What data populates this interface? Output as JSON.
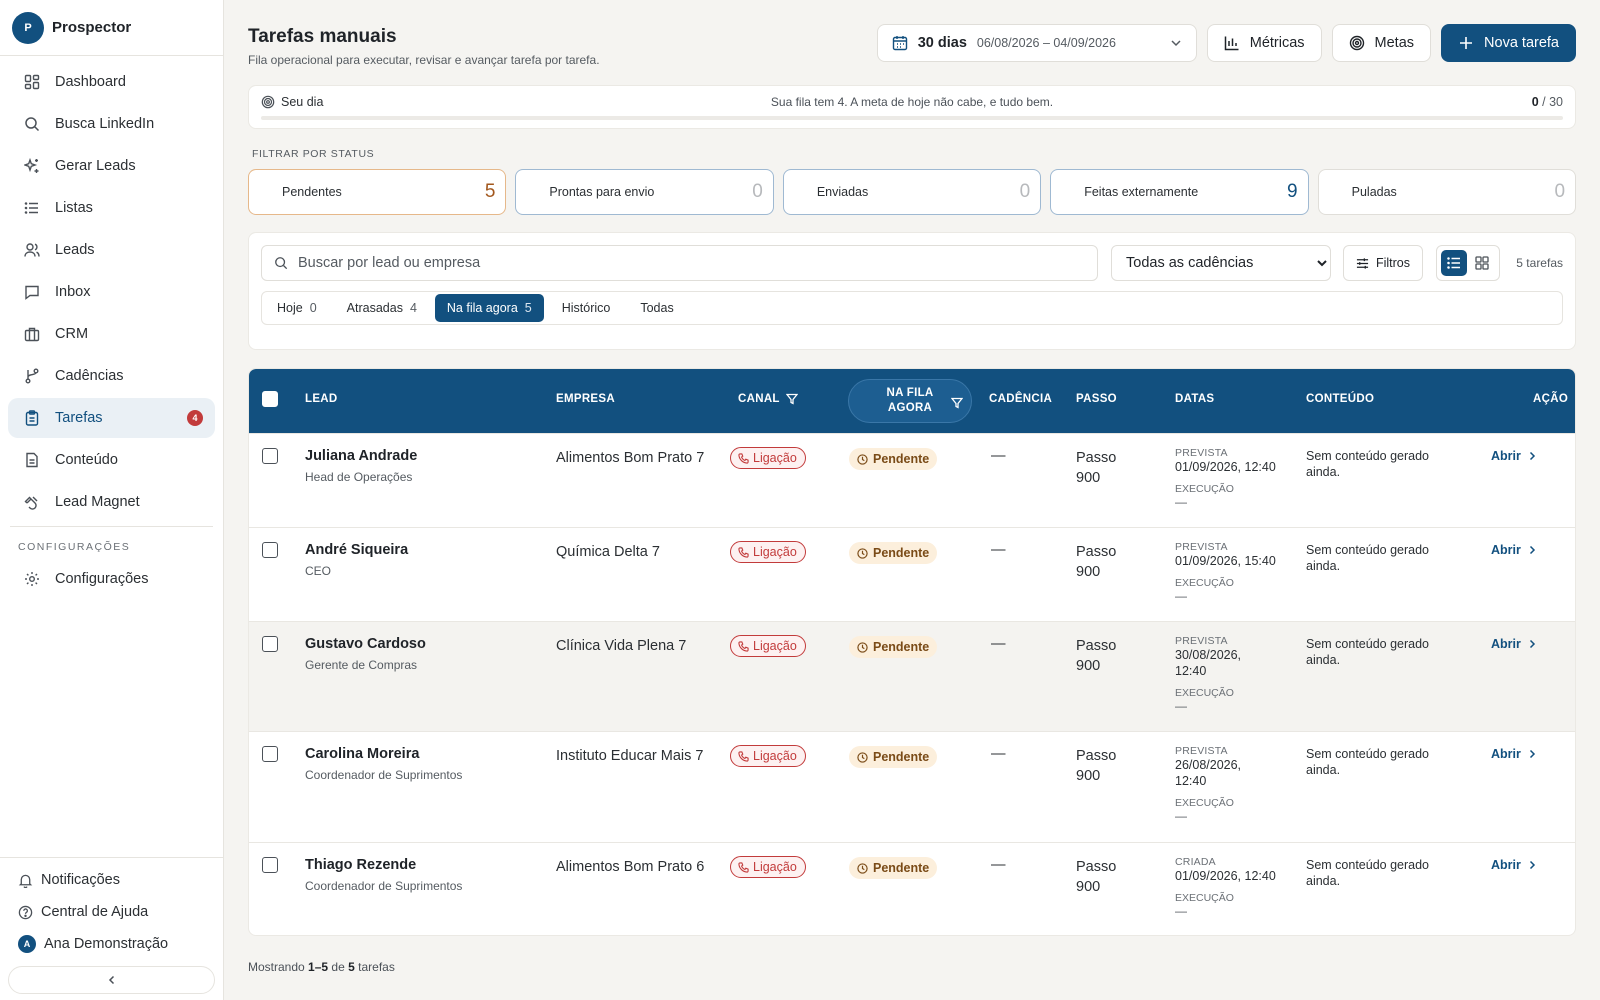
{
  "app": {
    "name": "Prospector",
    "logo_letter": "P"
  },
  "sidebar": {
    "items": [
      {
        "label": "Dashboard",
        "icon": "dashboard-icon"
      },
      {
        "label": "Busca LinkedIn",
        "icon": "search-icon"
      },
      {
        "label": "Gerar Leads",
        "icon": "sparkles-icon"
      },
      {
        "label": "Listas",
        "icon": "list-icon"
      },
      {
        "label": "Leads",
        "icon": "users-icon"
      },
      {
        "label": "Inbox",
        "icon": "message-icon"
      },
      {
        "label": "CRM",
        "icon": "briefcase-icon"
      },
      {
        "label": "Cadências",
        "icon": "branch-icon"
      },
      {
        "label": "Tarefas",
        "icon": "clipboard-icon",
        "badge": "4",
        "active": true
      },
      {
        "label": "Conteúdo",
        "icon": "document-icon"
      },
      {
        "label": "Lead Magnet",
        "icon": "magnet-icon"
      }
    ],
    "section_label": "CONFIGURAÇÕES",
    "settings_label": "Configurações",
    "notifications_label": "Notificações",
    "help_label": "Central de Ajuda",
    "user_name": "Ana Demonstração",
    "user_initial": "A"
  },
  "header": {
    "title": "Tarefas manuais",
    "subtitle": "Fila operacional para executar, revisar e avançar tarefa por tarefa.",
    "date_main": "30 dias",
    "date_range": "06/08/2026 – 04/09/2026",
    "metrics_label": "Métricas",
    "goals_label": "Metas",
    "new_task_label": "Nova tarefa"
  },
  "day": {
    "label": "Seu dia",
    "message": "Sua fila tem 4. A meta de hoje não cabe, e tudo bem.",
    "done": "0",
    "total": "/ 30",
    "progress": 0
  },
  "status_filter": {
    "title": "FILTRAR POR STATUS",
    "cards": [
      {
        "label": "Pendentes",
        "count": "5"
      },
      {
        "label": "Prontas para envio",
        "count": "0"
      },
      {
        "label": "Enviadas",
        "count": "0"
      },
      {
        "label": "Feitas externamente",
        "count": "9"
      },
      {
        "label": "Puladas",
        "count": "0"
      }
    ]
  },
  "search": {
    "placeholder": "Buscar por lead ou empresa",
    "value": "",
    "cadence_select": "Todas as cadências",
    "filters_label": "Filtros",
    "count_label": "5 tarefas"
  },
  "tabs": [
    {
      "label": "Hoje",
      "count": "0"
    },
    {
      "label": "Atrasadas",
      "count": "4"
    },
    {
      "label": "Na fila agora",
      "count": "5",
      "active": true
    },
    {
      "label": "Histórico",
      "count": ""
    },
    {
      "label": "Todas",
      "count": ""
    }
  ],
  "table": {
    "headers": {
      "lead": "LEAD",
      "company": "EMPRESA",
      "channel": "CANAL",
      "queue": "NA FILA AGORA",
      "cadence": "CADÊNCIA",
      "step": "PASSO",
      "dates": "DATAS",
      "content": "CONTEÚDO",
      "action": "AÇÃO"
    },
    "rows": [
      {
        "name": "Juliana Andrade",
        "role": "Head de Operações",
        "company": "Alimentos Bom Prato 7",
        "channel": "Ligação",
        "status": "Pendente",
        "cadence": "—",
        "step": "Passo 900",
        "date_label": "PREVISTA",
        "date_value": "01/09/2026, 12:40",
        "exec_label": "EXECUÇÃO",
        "exec_value": "—",
        "content": "Sem conteúdo gerado ainda.",
        "action": "Abrir"
      },
      {
        "name": "André Siqueira",
        "role": "CEO",
        "company": "Química Delta 7",
        "channel": "Ligação",
        "status": "Pendente",
        "cadence": "—",
        "step": "Passo 900",
        "date_label": "PREVISTA",
        "date_value": "01/09/2026, 15:40",
        "exec_label": "EXECUÇÃO",
        "exec_value": "—",
        "content": "Sem conteúdo gerado ainda.",
        "action": "Abrir"
      },
      {
        "name": "Gustavo Cardoso",
        "role": "Gerente de Compras",
        "company": "Clínica Vida Plena 7",
        "channel": "Ligação",
        "status": "Pendente",
        "cadence": "—",
        "step": "Passo 900",
        "date_label": "PREVISTA",
        "date_value": "30/08/2026, 12:40",
        "exec_label": "EXECUÇÃO",
        "exec_value": "—",
        "content": "Sem conteúdo gerado ainda.",
        "action": "Abrir"
      },
      {
        "name": "Carolina Moreira",
        "role": "Coordenador de Suprimentos",
        "company": "Instituto Educar Mais 7",
        "channel": "Ligação",
        "status": "Pendente",
        "cadence": "—",
        "step": "Passo 900",
        "date_label": "PREVISTA",
        "date_value": "26/08/2026, 12:40",
        "exec_label": "EXECUÇÃO",
        "exec_value": "—",
        "content": "Sem conteúdo gerado ainda.",
        "action": "Abrir"
      },
      {
        "name": "Thiago Rezende",
        "role": "Coordenador de Suprimentos",
        "company": "Alimentos Bom Prato 6",
        "channel": "Ligação",
        "status": "Pendente",
        "cadence": "—",
        "step": "Passo 900",
        "date_label": "CRIADA",
        "date_value": "01/09/2026, 12:40",
        "exec_label": "EXECUÇÃO",
        "exec_value": "—",
        "content": "Sem conteúdo gerado ainda.",
        "action": "Abrir"
      }
    ]
  },
  "footer": {
    "prefix": "Mostrando",
    "range": "1–5",
    "of": "de",
    "total": "5",
    "suffix": "tarefas"
  },
  "colors": {
    "primary": "#12507f",
    "danger": "#c23b3b",
    "pending_bg": "#fcefdc",
    "pending_text": "#7a4b17"
  }
}
